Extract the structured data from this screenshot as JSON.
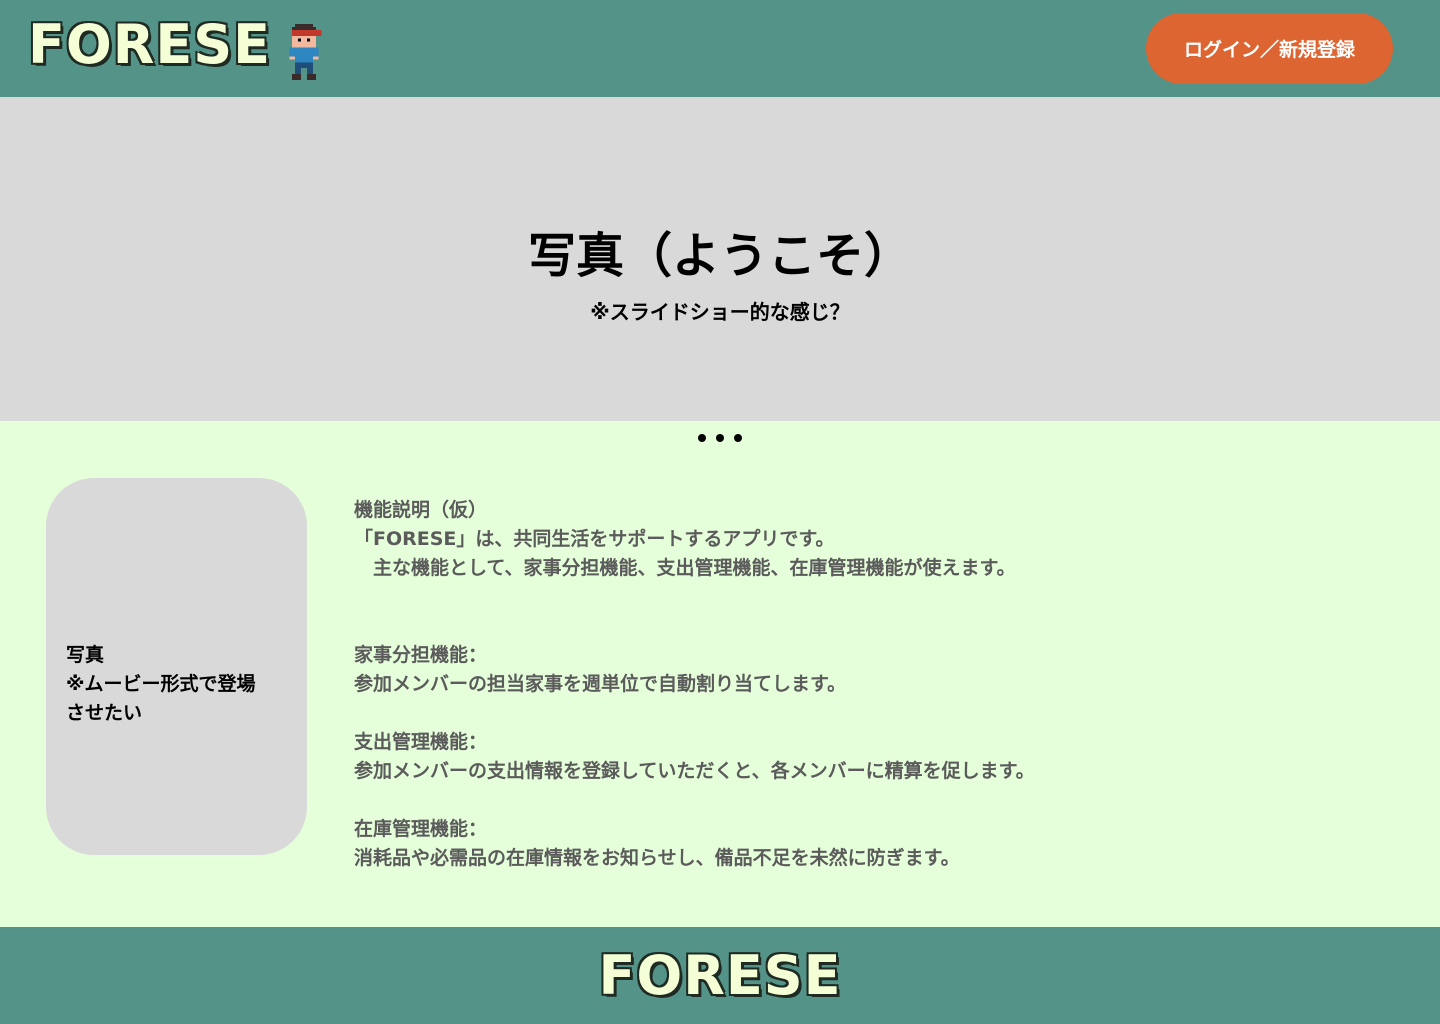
{
  "header": {
    "logo": "FORESE",
    "login_label": "ログイン／新規登録"
  },
  "hero": {
    "title": "写真（ようこそ）",
    "subtitle": "※スライドショー的な感じ？",
    "slide_count": 3
  },
  "photo_card": {
    "line1": "写真",
    "line2": "※ムービー形式で登場",
    "line3": "させたい"
  },
  "features": {
    "heading": "機能説明（仮）",
    "intro1": "「FORESE」は、共同生活をサポートするアプリです。",
    "intro2": "　主な機能として、家事分担機能、支出管理機能、在庫管理機能が使えます。",
    "items": [
      {
        "title": "家事分担機能：",
        "desc": "参加メンバーの担当家事を週単位で自動割り当てします。"
      },
      {
        "title": "支出管理機能：",
        "desc": "参加メンバーの支出情報を登録していただくと、各メンバーに精算を促します。"
      },
      {
        "title": "在庫管理機能：",
        "desc": "消耗品や必需品の在庫情報をお知らせし、備品不足を未然に防ぎます。"
      }
    ]
  },
  "footer": {
    "logo": "FORESE"
  },
  "colors": {
    "header_bg": "#549387",
    "accent_button": "#dc6532",
    "page_bg": "#e6ffdb",
    "placeholder_gray": "#d9d9d9"
  }
}
